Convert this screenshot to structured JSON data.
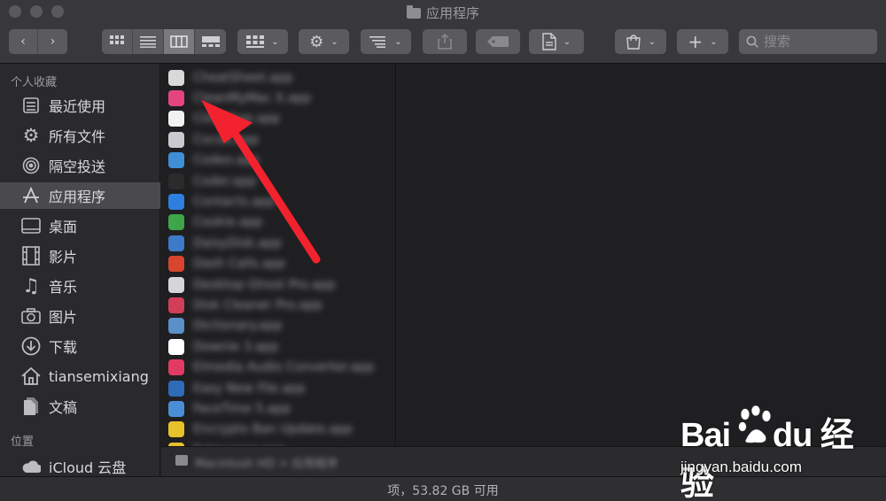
{
  "window": {
    "title": "应用程序"
  },
  "toolbar": {
    "search_placeholder": "搜索"
  },
  "sidebar": {
    "favorites_title": "个人收藏",
    "locations_title": "位置",
    "items": [
      {
        "label": "最近使用",
        "icon": "recents-icon"
      },
      {
        "label": "所有文件",
        "icon": "gear-icon"
      },
      {
        "label": "隔空投送",
        "icon": "airdrop-icon"
      },
      {
        "label": "应用程序",
        "icon": "applications-icon",
        "selected": true
      },
      {
        "label": "桌面",
        "icon": "desktop-icon"
      },
      {
        "label": "影片",
        "icon": "film-icon"
      },
      {
        "label": "音乐",
        "icon": "music-icon"
      },
      {
        "label": "图片",
        "icon": "camera-icon"
      },
      {
        "label": "下载",
        "icon": "download-icon"
      },
      {
        "label": "tiansemixiang",
        "icon": "home-icon"
      },
      {
        "label": "文稿",
        "icon": "documents-icon"
      }
    ],
    "locations": [
      {
        "label": "iCloud 云盘",
        "icon": "cloud-icon"
      }
    ]
  },
  "files": [
    {
      "name": "CheatSheet.app",
      "color": "#d9d9d9"
    },
    {
      "name": "CleanMyMac X.app",
      "color": "#e4457f"
    },
    {
      "name": "CloudApp.app",
      "color": "#f2f2f2"
    },
    {
      "name": "Cocoa.app",
      "color": "#c9c9cf"
    },
    {
      "name": "Codeo.app",
      "color": "#3f8fd6"
    },
    {
      "name": "Coder.app",
      "color": "#2b2b2b"
    },
    {
      "name": "Contacts.app",
      "color": "#2f7fe0"
    },
    {
      "name": "Cookie.app",
      "color": "#3fa54a"
    },
    {
      "name": "DaisyDisk.app",
      "color": "#3f79c9"
    },
    {
      "name": "Dash Calls.app",
      "color": "#d8442e"
    },
    {
      "name": "Desktop Ghost Pro.app",
      "color": "#d6d6da"
    },
    {
      "name": "Disk Cleaner Pro.app",
      "color": "#d23d5a"
    },
    {
      "name": "Dictionary.app",
      "color": "#5a8fc7"
    },
    {
      "name": "Downie 3.app",
      "color": "#ffffff"
    },
    {
      "name": "Elmedia Audio Converter.app",
      "color": "#e23a63"
    },
    {
      "name": "Easy New File.app",
      "color": "#2e6bb8"
    },
    {
      "name": "FaceTime 5.app",
      "color": "#4a8fd6"
    },
    {
      "name": "Encrypto Ban Update.app",
      "color": "#e8c22a"
    },
    {
      "name": "Entourage.app",
      "color": "#e8c22a"
    }
  ],
  "pathbar": {
    "text": "Macintosh HD > 应用程序"
  },
  "status": {
    "text": "项，53.82 GB 可用"
  },
  "watermark": {
    "url": "jingyan.baidu.com"
  }
}
